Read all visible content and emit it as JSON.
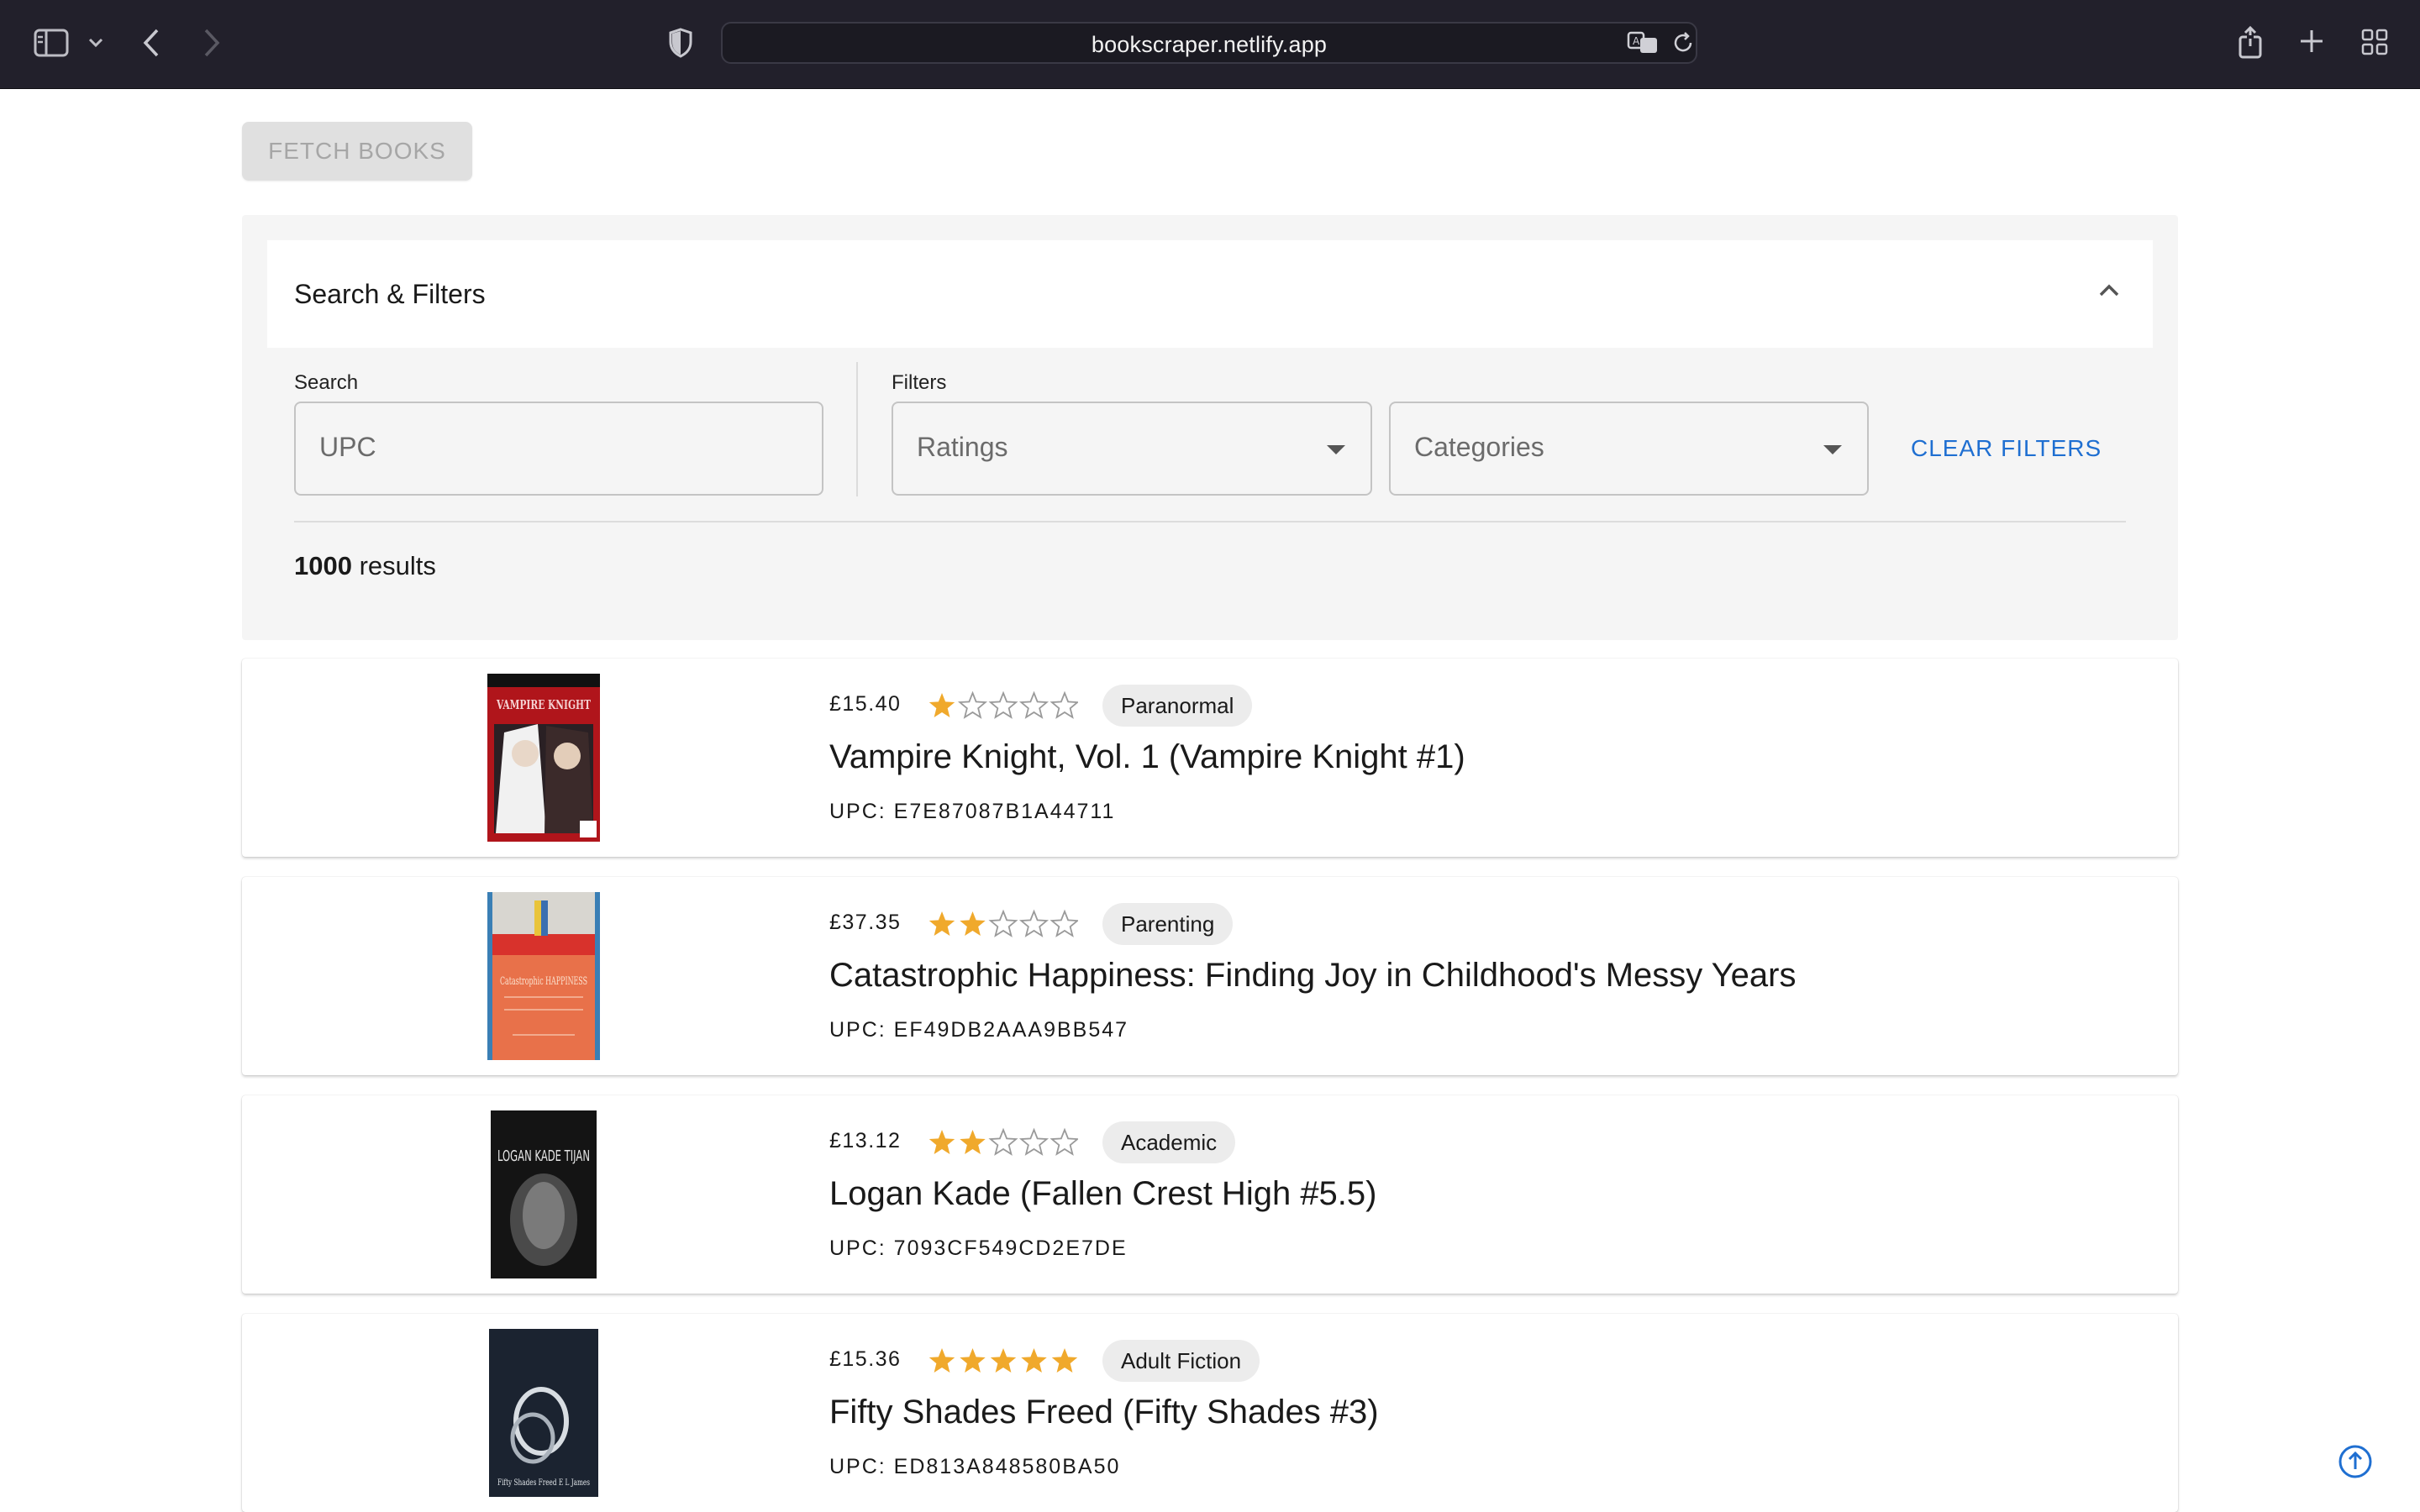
{
  "browser": {
    "url": "bookscraper.netlify.app"
  },
  "fetch_button": {
    "label": "FETCH BOOKS"
  },
  "filters": {
    "title": "Search & Filters",
    "search_label": "Search",
    "search_placeholder": "UPC",
    "filters_label": "Filters",
    "ratings_placeholder": "Ratings",
    "categories_placeholder": "Categories",
    "clear_label": "CLEAR FILTERS",
    "results_count": "1000",
    "results_suffix": " results"
  },
  "colors": {
    "star_filled": "#f0a92c",
    "star_empty": "#9a9a9a",
    "link_blue": "#1f6fd1"
  },
  "books": [
    {
      "price": "£15.40",
      "rating": 1,
      "category": "Paranormal",
      "title": "Vampire Knight, Vol. 1 (Vampire Knight #1)",
      "upc": "UPC: E7E87087B1A44711",
      "cover_text": "VAMPIRE KNIGHT"
    },
    {
      "price": "£37.35",
      "rating": 2,
      "category": "Parenting",
      "title": "Catastrophic Happiness: Finding Joy in Childhood's Messy Years",
      "upc": "UPC: EF49DB2AAA9BB547",
      "cover_text": "Catastrophic HAPPINESS"
    },
    {
      "price": "£13.12",
      "rating": 2,
      "category": "Academic",
      "title": "Logan Kade (Fallen Crest High #5.5)",
      "upc": "UPC: 7093CF549CD2E7DE",
      "cover_text": "LOGAN KADE TIJAN"
    },
    {
      "price": "£15.36",
      "rating": 5,
      "category": "Adult Fiction",
      "title": "Fifty Shades Freed (Fifty Shades #3)",
      "upc": "UPC: ED813A848580BA50",
      "cover_text": "Fifty Shades Freed E L James"
    }
  ]
}
